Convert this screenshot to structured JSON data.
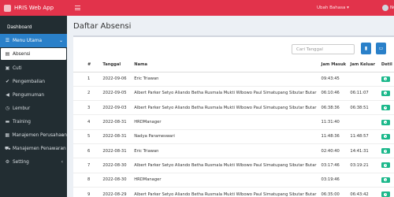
{
  "app": {
    "name": "HRIS Web App"
  },
  "topbar": {
    "language": "Ubah Bahasa",
    "user": "Nu"
  },
  "sidebar": {
    "items": [
      {
        "label": "Dashboard",
        "icon": "",
        "name": "sidebar-item-dashboard"
      },
      {
        "label": "Menu Utama",
        "icon": "list-icon",
        "name": "sidebar-item-menu-utama"
      },
      {
        "label": "Absensi",
        "icon": "clipboard-icon",
        "name": "sidebar-item-absensi"
      },
      {
        "label": "Cuti",
        "icon": "briefcase-icon",
        "name": "sidebar-item-cuti"
      },
      {
        "label": "Pengembalian",
        "icon": "check-icon",
        "name": "sidebar-item-pengembalian"
      },
      {
        "label": "Pengumuman",
        "icon": "megaphone-icon",
        "name": "sidebar-item-pengumuman"
      },
      {
        "label": "Lembur",
        "icon": "clock-icon",
        "name": "sidebar-item-lembur"
      },
      {
        "label": "Training",
        "icon": "book-icon",
        "name": "sidebar-item-training"
      },
      {
        "label": "Manajemen Perusahaan",
        "icon": "building-icon",
        "name": "sidebar-item-manajemen-perusahaan"
      },
      {
        "label": "Manajemen Penawaran",
        "icon": "cart-icon",
        "name": "sidebar-item-manajemen-penawaran"
      },
      {
        "label": "Setting",
        "icon": "gear-icon",
        "name": "sidebar-item-setting"
      }
    ]
  },
  "page": {
    "title": "Daftar Absensi"
  },
  "filter": {
    "placeholder": "Cari Tanggal"
  },
  "table": {
    "headers": {
      "no": "#",
      "tanggal": "Tanggal",
      "nama": "Nama",
      "jam_masuk": "Jam Masuk",
      "jam_keluar": "Jam Keluar",
      "detil": "Detil"
    },
    "rows": [
      {
        "no": "1",
        "tanggal": "2022-09-06",
        "nama": "Eric Triawan",
        "jam_masuk": "09:43:45",
        "jam_keluar": ""
      },
      {
        "no": "2",
        "tanggal": "2022-09-05",
        "nama": "Albert Parker Setyo Aliando Betha Rusmala Mukti Wibowo Paul Simatupang Sibutar Butar",
        "jam_masuk": "06:10:46",
        "jam_keluar": "06:11:07"
      },
      {
        "no": "3",
        "tanggal": "2022-09-03",
        "nama": "Albert Parker Setyo Aliando Betha Rusmala Mukti Wibowo Paul Simatupang Sibutar Butar",
        "jam_masuk": "06:38:36",
        "jam_keluar": "06:38:51"
      },
      {
        "no": "4",
        "tanggal": "2022-08-31",
        "nama": "HRDManager",
        "jam_masuk": "11:31:40",
        "jam_keluar": ""
      },
      {
        "no": "5",
        "tanggal": "2022-08-31",
        "nama": "Nadya Parameswari",
        "jam_masuk": "11:48:36",
        "jam_keluar": "11:48:57"
      },
      {
        "no": "6",
        "tanggal": "2022-08-31",
        "nama": "Eric Triawan",
        "jam_masuk": "02:40:40",
        "jam_keluar": "14:41:31"
      },
      {
        "no": "7",
        "tanggal": "2022-08-30",
        "nama": "Albert Parker Setyo Aliando Betha Rusmala Mukti Wibowo Paul Simatupang Sibutar Butar",
        "jam_masuk": "03:17:46",
        "jam_keluar": "03:19:21"
      },
      {
        "no": "8",
        "tanggal": "2022-08-30",
        "nama": "HRDManager",
        "jam_masuk": "03:19:46",
        "jam_keluar": ""
      },
      {
        "no": "9",
        "tanggal": "2022-08-29",
        "nama": "Albert Parker Setyo Aliando Betha Rusmala Mukti Wibowo Paul Simatupang Sibutar Butar",
        "jam_masuk": "06:35:00",
        "jam_keluar": "06:43:42"
      }
    ]
  }
}
